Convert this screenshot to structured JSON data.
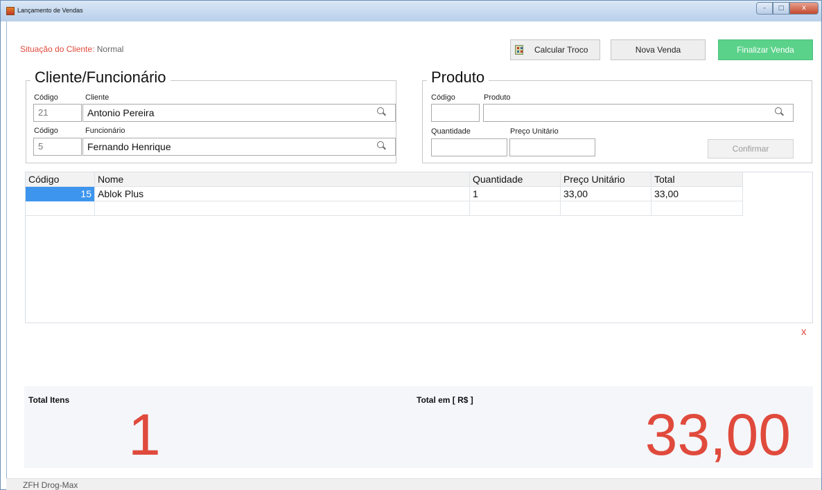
{
  "window": {
    "title": "Lançamento de Vendas"
  },
  "situacao": {
    "label": "Situação do Cliente:",
    "value": "Normal"
  },
  "toolbar": {
    "calcular_troco": "Calcular Troco",
    "nova_venda": "Nova Venda",
    "finalizar_venda": "Finalizar Venda"
  },
  "cliente_group": {
    "title": "Cliente/Funcionário",
    "codigo_cliente_label": "Código",
    "cliente_label": "Cliente",
    "codigo_cliente_value": "21",
    "cliente_value": "Antonio Pereira",
    "codigo_func_label": "Código",
    "func_label": "Funcionário",
    "codigo_func_value": "5",
    "func_value": "Fernando Henrique"
  },
  "produto_group": {
    "title": "Produto",
    "codigo_label": "Código",
    "produto_label": "Produto",
    "quantidade_label": "Quantidade",
    "preco_label": "Preço Unitário",
    "confirmar": "Confirmar"
  },
  "grid": {
    "columns": [
      "Código",
      "Nome",
      "Quantidade",
      "Preço Unitário",
      "Total"
    ],
    "rows": [
      [
        "15",
        "Ablok Plus",
        "1",
        "33,00",
        "33,00"
      ]
    ]
  },
  "remove_label": "x",
  "totals": {
    "items_label": "Total  Itens",
    "items_value": "1",
    "value_label": "Total em [ R$ ]",
    "value": "33,00"
  },
  "status": {
    "text": "ZFH Drog-Max"
  },
  "colors": {
    "accent_red": "#e04a3c",
    "finalizar_green": "#5bd28a",
    "selection_blue": "#3d95ee"
  }
}
